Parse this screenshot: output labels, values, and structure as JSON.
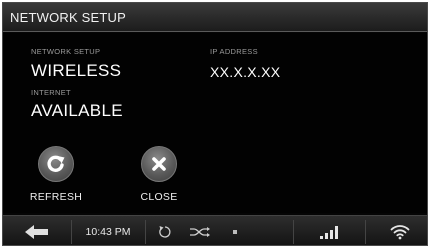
{
  "window": {
    "title": "NETWORK SETUP"
  },
  "info": {
    "network_setup_label": "NETWORK SETUP",
    "network_setup_value": "WIRELESS",
    "internet_label": "INTERNET",
    "internet_value": "AVAILABLE",
    "ip_label": "IP ADDRESS",
    "ip_value": "XX.X.X.XX"
  },
  "actions": {
    "refresh_label": "REFRESH",
    "refresh_icon": "refresh-icon",
    "close_label": "CLOSE",
    "close_icon": "close-icon"
  },
  "taskbar": {
    "back_icon": "back-arrow-icon",
    "time": "10:43 PM",
    "rotate_icon": "rotate-icon",
    "shuffle_icon": "shuffle-icon",
    "stop_icon": "stop-icon",
    "signal_icon": "signal-strength-icon",
    "wifi_icon": "wifi-icon"
  },
  "colors": {
    "background": "#050505",
    "titlebar": "#2a2a2a",
    "text": "#ffffff",
    "label": "#9a9a9a",
    "button": "#6a6a6a"
  }
}
